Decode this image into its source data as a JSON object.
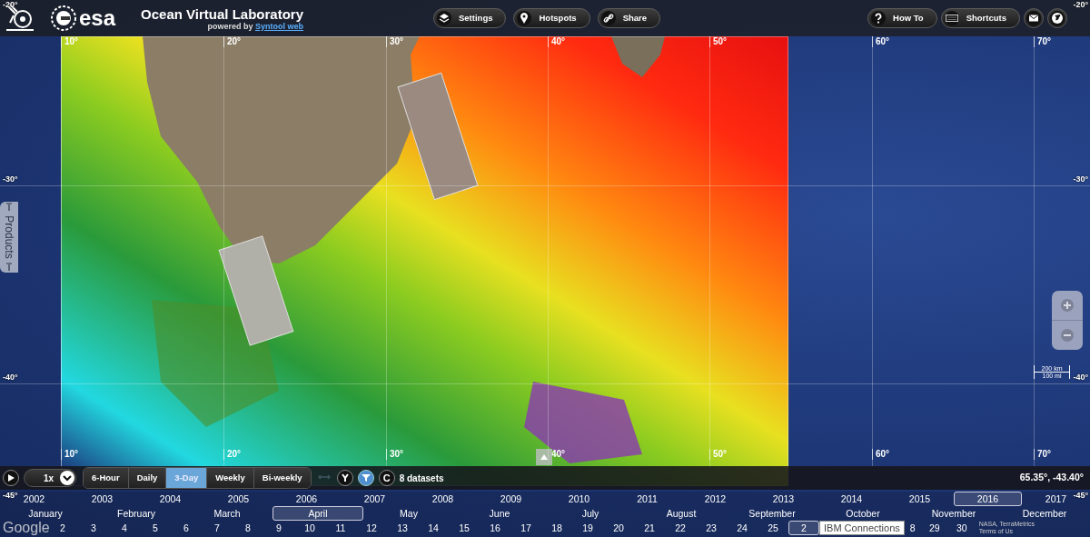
{
  "header": {
    "title": "Ocean Virtual Laboratory",
    "powered_by": "powered by",
    "powered_link": "Syntool web",
    "logo_text": "esa"
  },
  "top_buttons": [
    {
      "kind": "layers",
      "label": "Settings"
    },
    {
      "kind": "pin",
      "label": "Hotspots"
    },
    {
      "kind": "link",
      "label": "Share"
    }
  ],
  "right_buttons": [
    {
      "kind": "help",
      "label": "How To"
    },
    {
      "kind": "keyboard",
      "label": "Shortcuts"
    },
    {
      "kind": "mail"
    },
    {
      "kind": "globe"
    }
  ],
  "side_tab": {
    "label": "Products"
  },
  "map_labels": {
    "lon_top": [
      "10°",
      "20°",
      "30°",
      "40°",
      "50°",
      "60°",
      "70°"
    ],
    "lon_bottom": [
      "10°",
      "20°",
      "30°",
      "40°",
      "50°",
      "60°",
      "70°"
    ],
    "lat_left": [
      "-20°",
      "-30°",
      "-40°",
      "-45°"
    ],
    "lat_right": [
      "-20°",
      "-30°",
      "-40°",
      "-45°"
    ]
  },
  "scale": {
    "metric": "200 km",
    "imperial": "100 mi"
  },
  "playback": {
    "speed": "1x",
    "intervals": [
      {
        "label": "6-Hour",
        "selected": false
      },
      {
        "label": "Daily",
        "selected": false
      },
      {
        "label": "3-Day",
        "selected": true
      },
      {
        "label": "Weekly",
        "selected": false
      },
      {
        "label": "Bi-weekly",
        "selected": false
      }
    ],
    "tools": [
      {
        "kind": "swap",
        "active": false
      },
      {
        "kind": "merge",
        "active": false
      },
      {
        "kind": "filter",
        "active": true
      },
      {
        "kind": "clear",
        "label": "C",
        "active": false
      }
    ],
    "datasets": "8 datasets",
    "coordinates": "65.35°, -43.40°"
  },
  "timeline": {
    "years": [
      {
        "label": "2002",
        "selected": false
      },
      {
        "label": "2003",
        "selected": false
      },
      {
        "label": "2004",
        "selected": false
      },
      {
        "label": "2005",
        "selected": false
      },
      {
        "label": "2006",
        "selected": false
      },
      {
        "label": "2007",
        "selected": false
      },
      {
        "label": "2008",
        "selected": false
      },
      {
        "label": "2009",
        "selected": false
      },
      {
        "label": "2010",
        "selected": false
      },
      {
        "label": "2011",
        "selected": false
      },
      {
        "label": "2012",
        "selected": false
      },
      {
        "label": "2013",
        "selected": false
      },
      {
        "label": "2014",
        "selected": false
      },
      {
        "label": "2015",
        "selected": false
      },
      {
        "label": "2016",
        "selected": true
      },
      {
        "label": "2017",
        "selected": false
      }
    ],
    "months": [
      {
        "label": "January",
        "selected": false
      },
      {
        "label": "February",
        "selected": false
      },
      {
        "label": "March",
        "selected": false
      },
      {
        "label": "April",
        "selected": true
      },
      {
        "label": "May",
        "selected": false
      },
      {
        "label": "June",
        "selected": false
      },
      {
        "label": "July",
        "selected": false
      },
      {
        "label": "August",
        "selected": false
      },
      {
        "label": "September",
        "selected": false
      },
      {
        "label": "October",
        "selected": false
      },
      {
        "label": "November",
        "selected": false
      },
      {
        "label": "December",
        "selected": false
      }
    ],
    "days_before": [
      {
        "label": "2",
        "selected": false
      },
      {
        "label": "3",
        "selected": false
      },
      {
        "label": "4",
        "selected": false
      },
      {
        "label": "5",
        "selected": false
      },
      {
        "label": "6",
        "selected": false
      },
      {
        "label": "7",
        "selected": false
      },
      {
        "label": "8",
        "selected": false
      },
      {
        "label": "9",
        "selected": false
      },
      {
        "label": "10",
        "selected": false
      },
      {
        "label": "11",
        "selected": false
      },
      {
        "label": "12",
        "selected": false
      },
      {
        "label": "13",
        "selected": false
      },
      {
        "label": "14",
        "selected": false
      },
      {
        "label": "15",
        "selected": false
      },
      {
        "label": "16",
        "selected": false
      },
      {
        "label": "17",
        "selected": false
      },
      {
        "label": "18",
        "selected": false
      },
      {
        "label": "19",
        "selected": false
      },
      {
        "label": "20",
        "selected": false
      },
      {
        "label": "21",
        "selected": false
      },
      {
        "label": "22",
        "selected": false
      },
      {
        "label": "23",
        "selected": false
      },
      {
        "label": "24",
        "selected": false
      },
      {
        "label": "25",
        "selected": false
      },
      {
        "label": "2",
        "selected": true
      }
    ],
    "days_after": [
      {
        "label": "8",
        "selected": false
      },
      {
        "label": "29",
        "selected": false
      },
      {
        "label": "30",
        "selected": false
      }
    ]
  },
  "tooltip": "IBM Connections",
  "attribution": {
    "logo": "Google",
    "credits": "NASA, TerraMetrics",
    "terms": "Terms of Us"
  }
}
